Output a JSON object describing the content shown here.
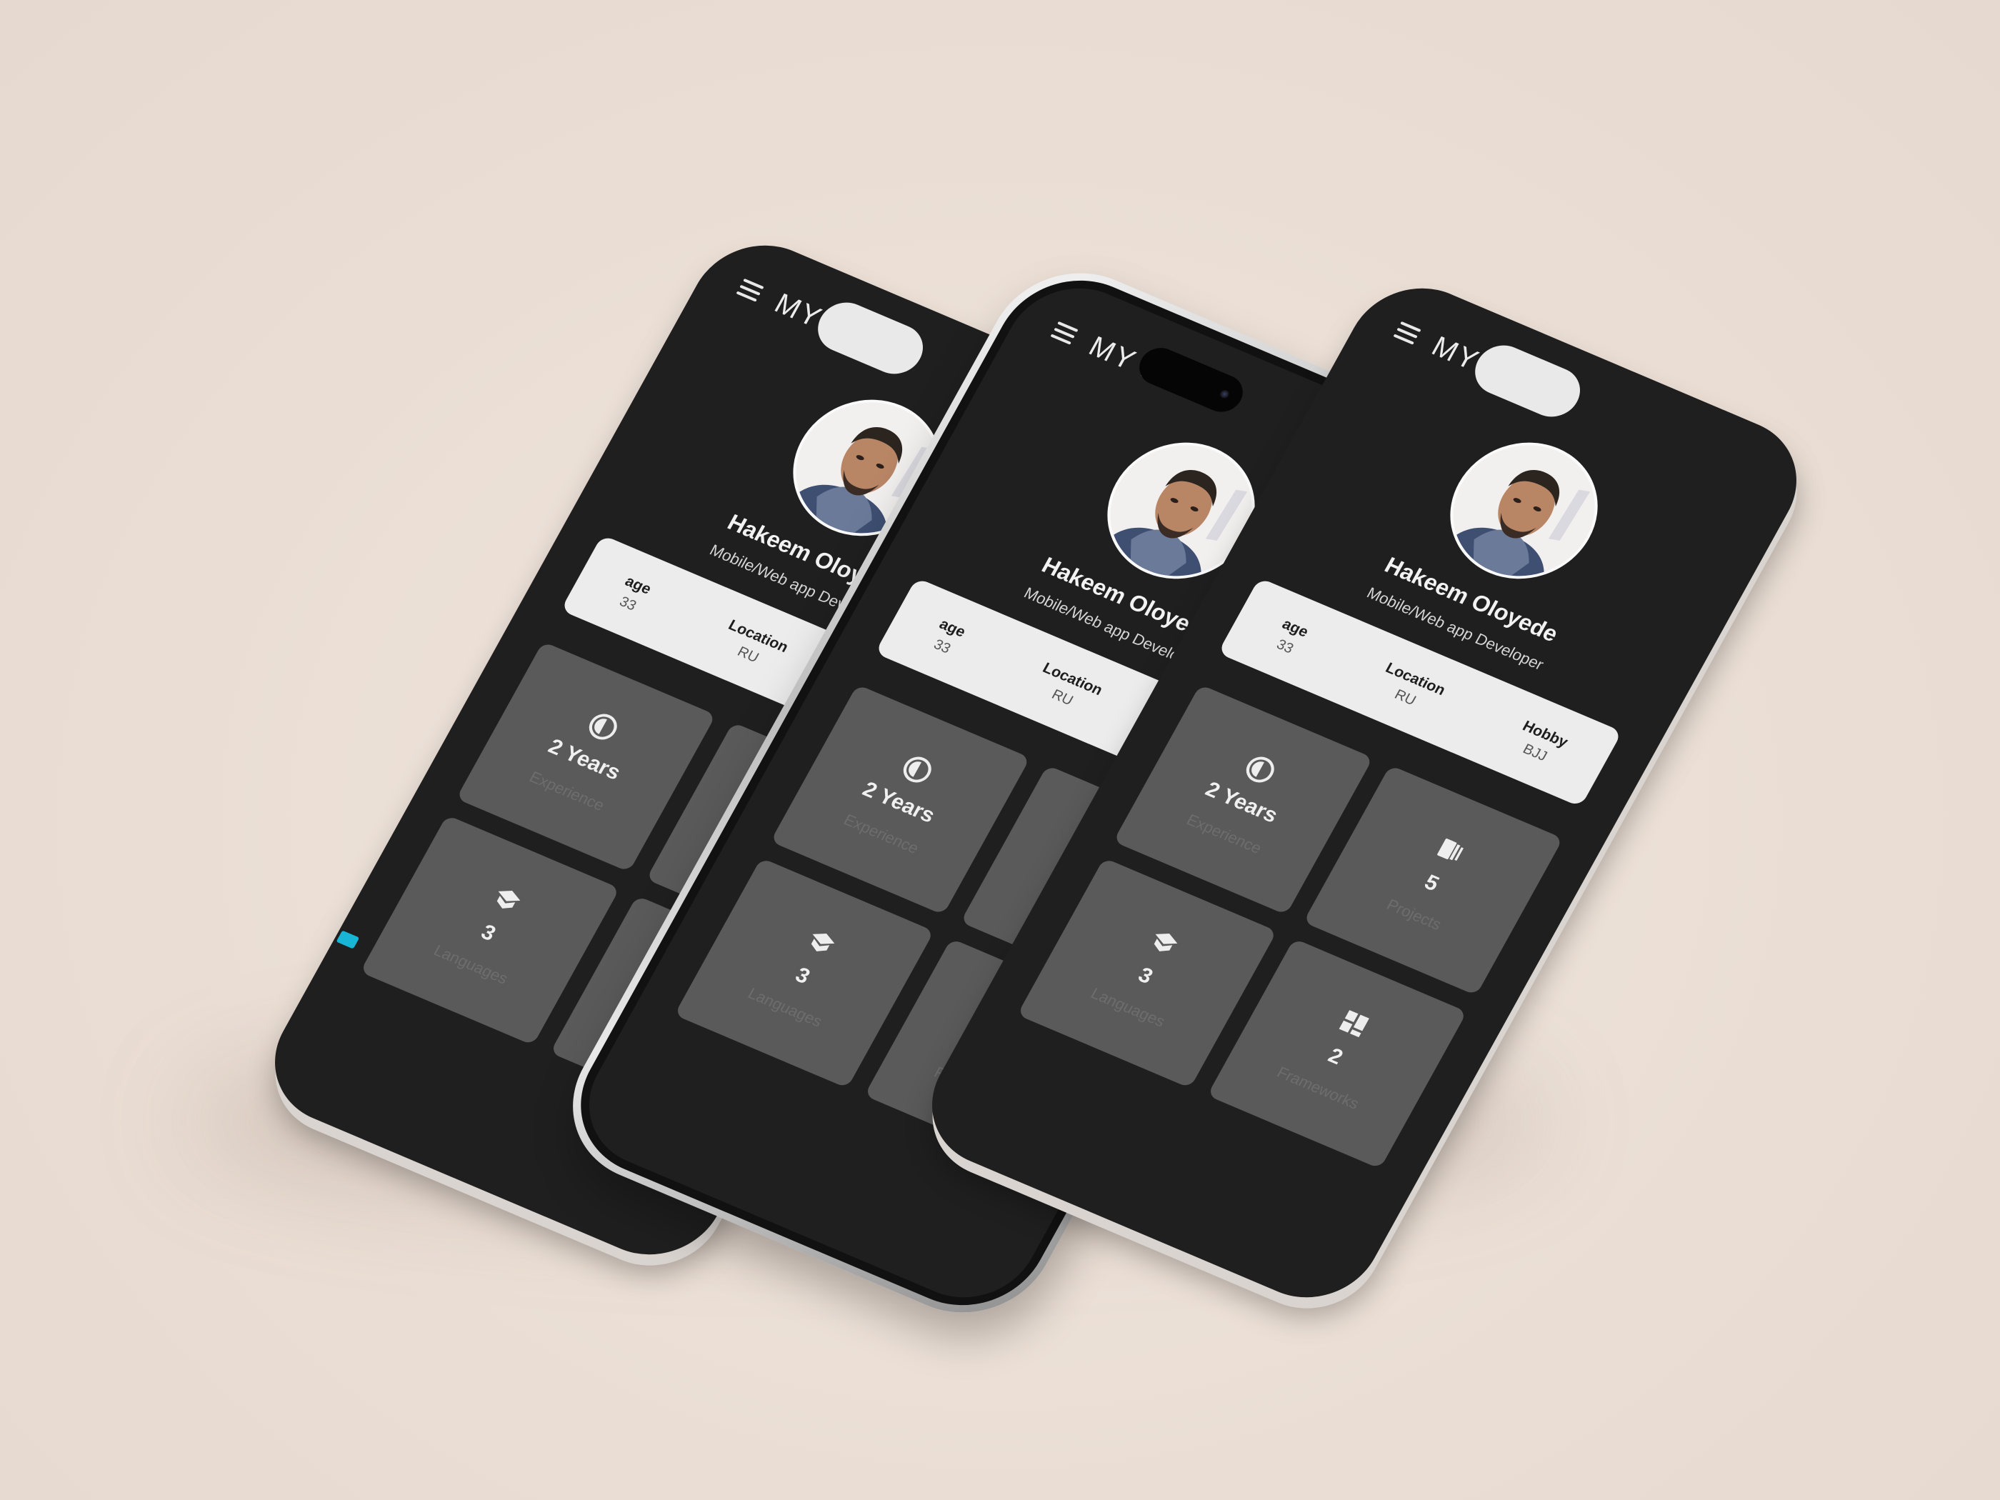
{
  "app": {
    "title": "MY PORTFOLIO",
    "menu_icon": "hamburger-menu-icon"
  },
  "profile": {
    "name": "Hakeem Oloyede",
    "role": "Mobile/Web app Developer",
    "avatar_icon": "profile-photo"
  },
  "info": {
    "age_label": "age",
    "age_value": "33",
    "location_label": "Location",
    "location_value": "RU",
    "hobby_label": "Hobby",
    "hobby_value": "BJJ"
  },
  "tiles": [
    {
      "icon": "experience-icon",
      "value": "2 Years",
      "label": "Experience"
    },
    {
      "icon": "projects-icon",
      "value": "5",
      "label": "Projects"
    },
    {
      "icon": "languages-icon",
      "value": "3",
      "label": "Languages"
    },
    {
      "icon": "frameworks-icon",
      "value": "2",
      "label": "Frameworks"
    }
  ],
  "colors": {
    "background": "#ece0d7",
    "screen": "#1f1f1f",
    "tile": "#5a5a5a",
    "info_card": "#ececec",
    "accent": "#19b5d6"
  }
}
